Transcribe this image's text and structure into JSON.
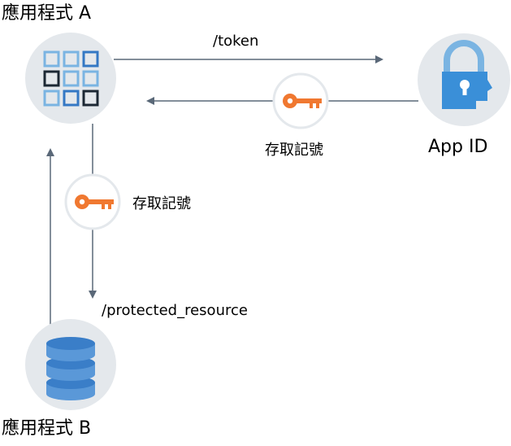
{
  "nodes": {
    "app_a": {
      "label": "應用程式 A"
    },
    "app_b": {
      "label": "應用程式 B"
    },
    "app_id": {
      "label": "App ID"
    }
  },
  "edges": {
    "token_request": {
      "label": "/token"
    },
    "token_return": {
      "label": "存取記號"
    },
    "token_forward": {
      "label": "存取記號"
    },
    "resource_request": {
      "label": "/protected_resource"
    }
  },
  "colors": {
    "node_bg": "#e4e8ec",
    "arrow": "#5a6878",
    "key": "#f07830",
    "grid_light": "#7ab4e2",
    "grid_dark": "#1c2834",
    "grid_blue": "#3478c4",
    "lock_body": "#3a8fd8",
    "lock_shackle": "#7ab4e2",
    "db_top": "#3a7ec8",
    "db_body": "#5a98d8"
  },
  "icons": {
    "app_a": "app-grid-icon",
    "app_id": "lock-head-icon",
    "app_b": "database-icon",
    "key": "key-icon"
  }
}
